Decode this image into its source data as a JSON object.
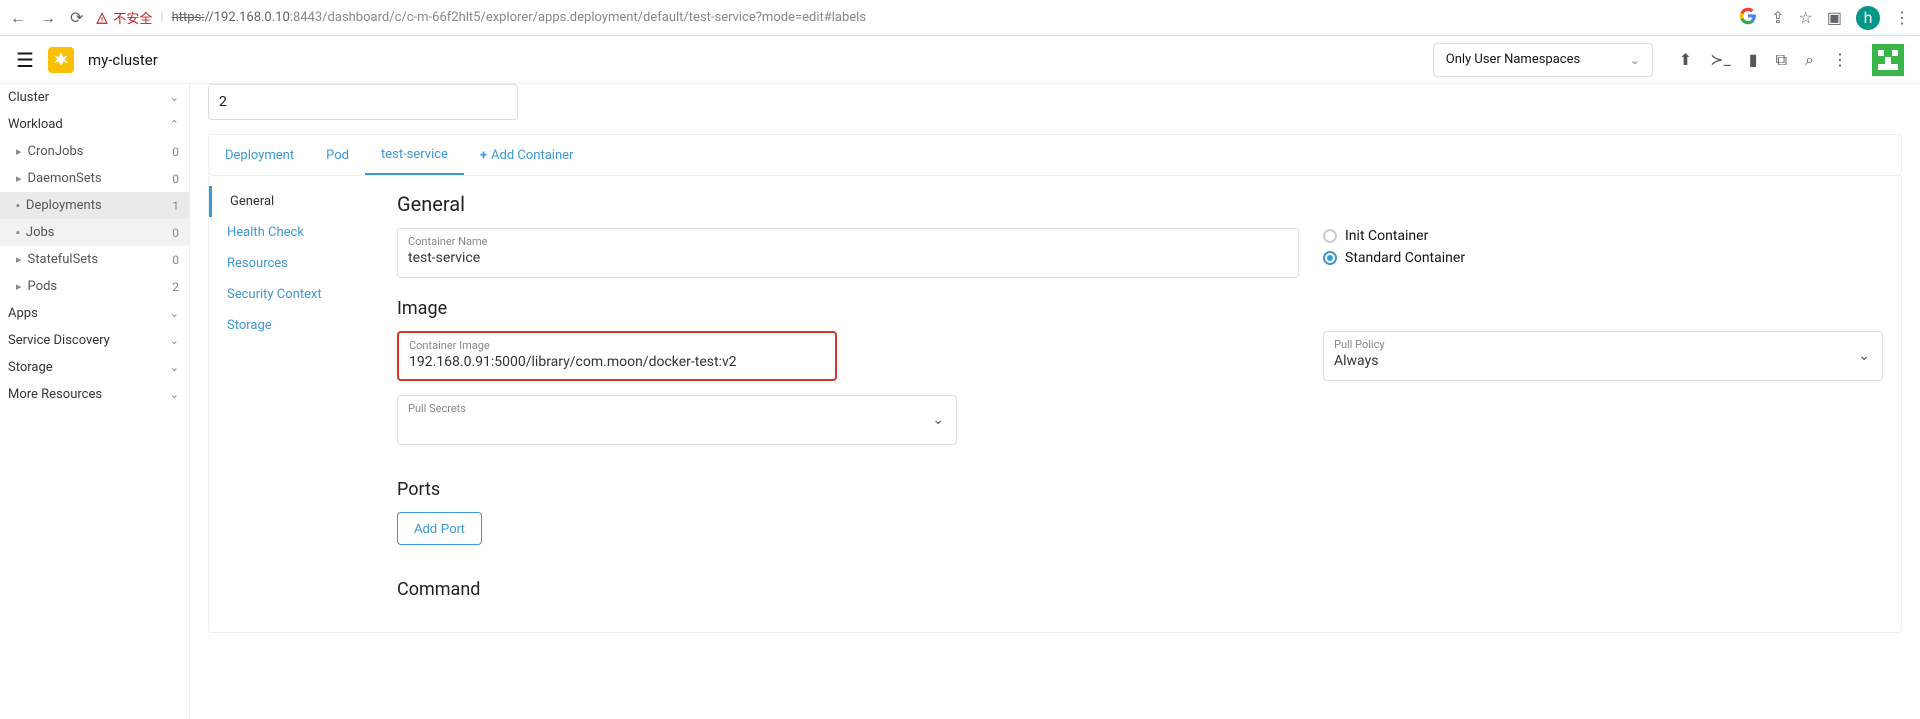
{
  "browser": {
    "insecure_label": "不安全",
    "url_proto": "https:",
    "url_host_prefix": "//192.168.0.10",
    "url_port": ":8443",
    "url_path": "/dashboard/c/c-m-66f2hlt5/explorer/apps.deployment/default/test-service?mode=edit#labels",
    "avatar_letter": "h"
  },
  "header": {
    "cluster_name": "my-cluster",
    "namespace_selector": "Only User Namespaces"
  },
  "sidebar": {
    "cluster": "Cluster",
    "workload": "Workload",
    "items": [
      {
        "label": "CronJobs",
        "count": "0"
      },
      {
        "label": "DaemonSets",
        "count": "0"
      },
      {
        "label": "Deployments",
        "count": "1"
      },
      {
        "label": "Jobs",
        "count": "0"
      },
      {
        "label": "StatefulSets",
        "count": "0"
      },
      {
        "label": "Pods",
        "count": "2"
      }
    ],
    "apps": "Apps",
    "service_discovery": "Service Discovery",
    "storage": "Storage",
    "more": "More Resources"
  },
  "replicas_value": "2",
  "tabs": {
    "t0": "Deployment",
    "t1": "Pod",
    "t2": "test-service",
    "add": "Add Container"
  },
  "inner_nav": {
    "general": "General",
    "health": "Health Check",
    "resources": "Resources",
    "security": "Security Context",
    "storage": "Storage"
  },
  "panel": {
    "general_title": "General",
    "container_name_label": "Container Name",
    "container_name_value": "test-service",
    "init_container": "Init Container",
    "standard_container": "Standard Container",
    "image_title": "Image",
    "container_image_label": "Container Image",
    "container_image_value": "192.168.0.91:5000/library/com.moon/docker-test:v2",
    "pull_policy_label": "Pull Policy",
    "pull_policy_value": "Always",
    "pull_secrets_label": "Pull Secrets",
    "ports_title": "Ports",
    "add_port_btn": "Add Port",
    "command_title": "Command"
  }
}
